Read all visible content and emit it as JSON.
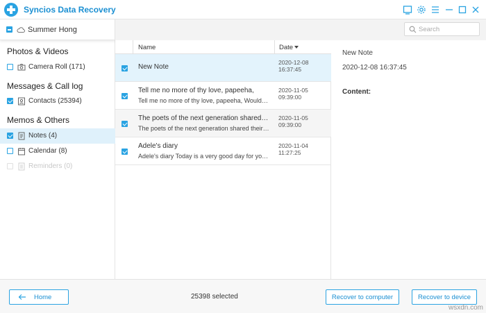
{
  "app": {
    "title": "Syncios Data Recovery"
  },
  "colors": {
    "accent": "#2aa3e2",
    "selected_row": "#e3f3fc"
  },
  "sidebar": {
    "account": "Summer Hong",
    "sections": [
      {
        "title": "Photos & Videos",
        "items": [
          {
            "label": "Camera Roll (171)",
            "icon": "camera-icon",
            "checked": false
          }
        ]
      },
      {
        "title": "Messages & Call log",
        "items": [
          {
            "label": "Contacts (25394)",
            "icon": "contacts-icon",
            "checked": true
          }
        ]
      },
      {
        "title": "Memos & Others",
        "items": [
          {
            "label": "Notes (4)",
            "icon": "notes-icon",
            "checked": true,
            "active": true
          },
          {
            "label": "Calendar (8)",
            "icon": "calendar-icon",
            "checked": false
          },
          {
            "label": "Reminders (0)",
            "icon": "reminders-icon",
            "checked": false,
            "disabled": true
          }
        ]
      }
    ]
  },
  "search": {
    "placeholder": "Search"
  },
  "list": {
    "columns": {
      "name": "Name",
      "date": "Date"
    },
    "rows": [
      {
        "title": "New Note",
        "subtitle": "",
        "date": "2020-12-08 16:37:45",
        "checked": true
      },
      {
        "title": "Tell me no more of thy love, papeeha,",
        "subtitle": "Tell me no more of thy love, papeeha, Wouldst thou remind me",
        "date": "2020-11-05 09:39:00",
        "checked": true
      },
      {
        "title": "The poets of the next generation shared their thoughts",
        "subtitle": "The poets of the next generation shared their presence",
        "date": "2020-11-05 09:39:00",
        "checked": true
      },
      {
        "title": "Adele's diary",
        "subtitle": "Adele's diary Today is a very good day for you. I'm happy",
        "date": "2020-11-04 11:27:25",
        "checked": true
      }
    ]
  },
  "detail": {
    "title": "New Note",
    "date": "2020-12-08 16:37:45",
    "content_label": "Content:"
  },
  "footer": {
    "home": "Home",
    "selected": "25398 selected",
    "recover_computer": "Recover to computer",
    "recover_device": "Recover to device"
  },
  "watermark": "wsxdn.com"
}
